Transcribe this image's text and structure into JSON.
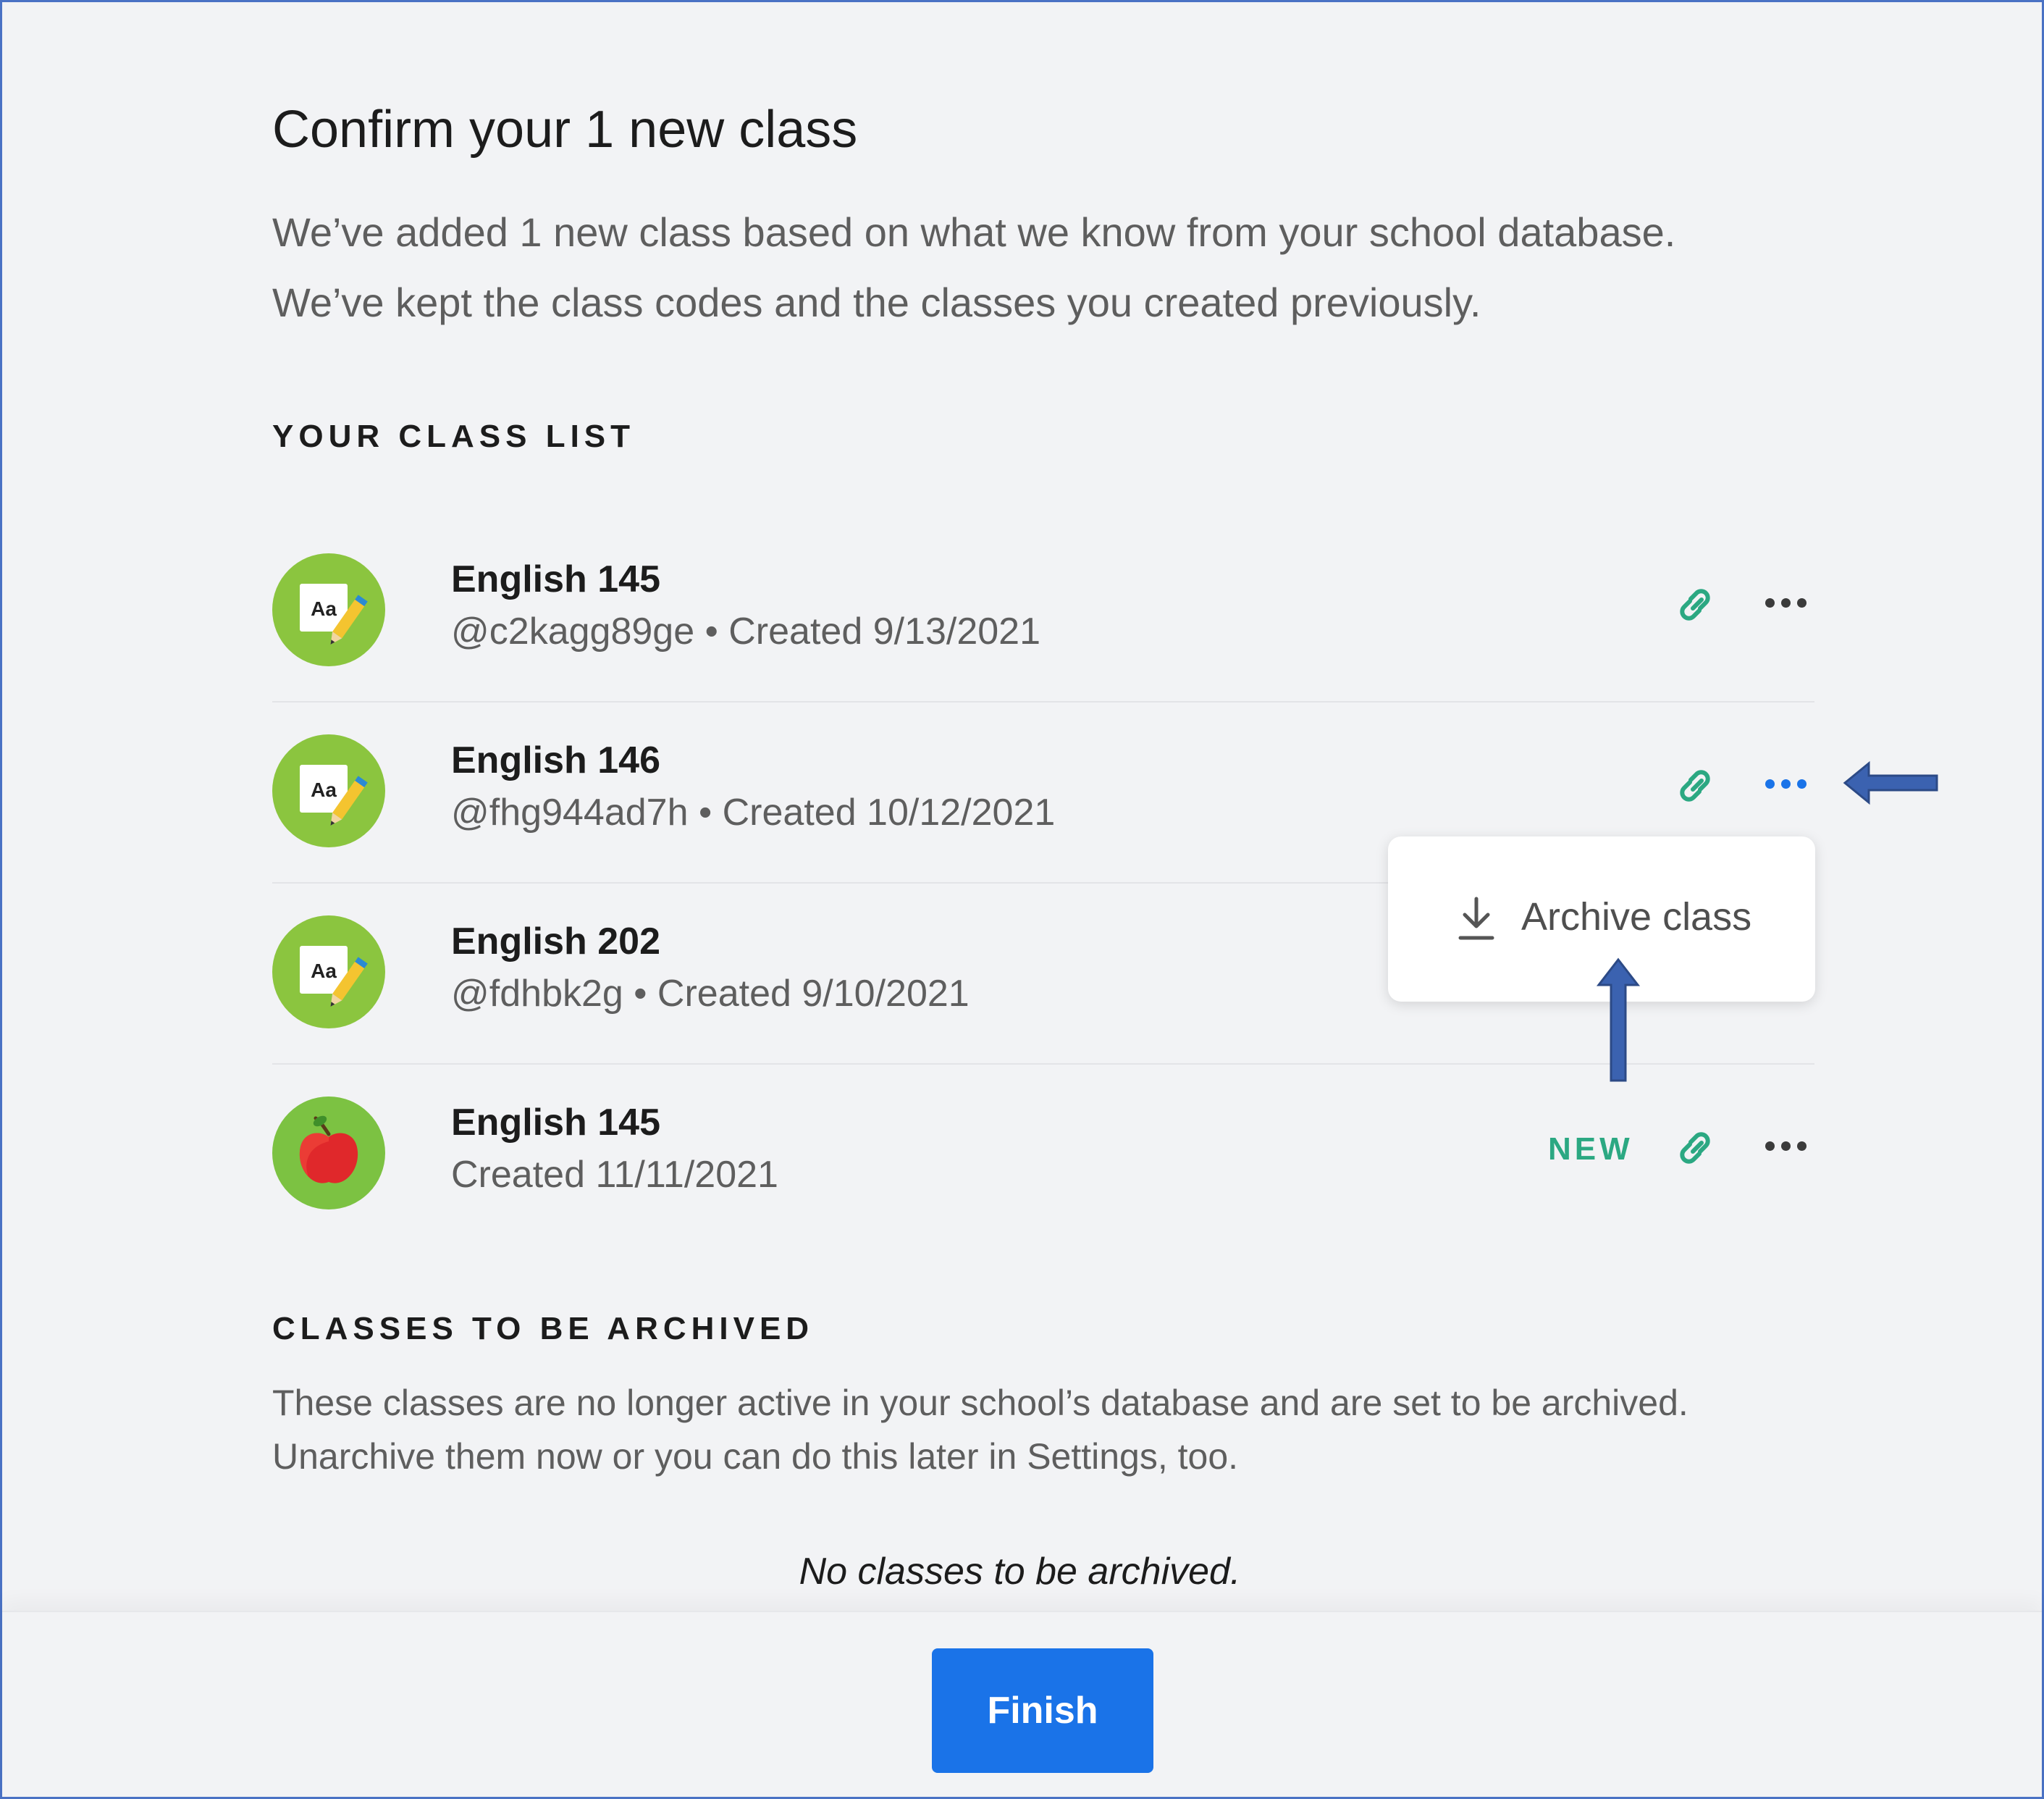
{
  "header": {
    "title": "Confirm your 1 new class",
    "subtitle_line1": "We’ve added 1 new class based on what we know from your school database.",
    "subtitle_line2": "We’ve kept the class codes and the classes you created previously."
  },
  "class_list": {
    "heading": "YOUR CLASS LIST",
    "items": [
      {
        "name": "English 145",
        "meta": "@c2kagg89ge • Created 9/13/2021",
        "avatar": "notebook-pencil-icon",
        "badge": ""
      },
      {
        "name": "English 146",
        "meta": "@fhg944ad7h • Created 10/12/2021",
        "avatar": "notebook-pencil-icon",
        "badge": ""
      },
      {
        "name": "English 202",
        "meta": "@fdhbk2g • Created 9/10/2021",
        "avatar": "notebook-pencil-icon",
        "badge": ""
      },
      {
        "name": "English 145",
        "meta": "Created 11/11/2021",
        "avatar": "apple-icon",
        "badge": "NEW"
      }
    ]
  },
  "menu": {
    "archive_label": "Archive class",
    "archive_icon": "download-icon"
  },
  "archived": {
    "heading": "CLASSES TO BE ARCHIVED",
    "desc_line1": "These classes are no longer active in your school’s database and are set to be archived.",
    "desc_line2": "Unarchive them now or you can do this later in Settings, too.",
    "empty_note": "No classes to be archived."
  },
  "footer": {
    "finish_label": "Finish"
  },
  "colors": {
    "primary": "#1a73e8",
    "accent_green": "#2ba882",
    "avatar_green": "#8bc53f",
    "annotation_arrow": "#3b62b0",
    "frame_border": "#4a72c4"
  }
}
